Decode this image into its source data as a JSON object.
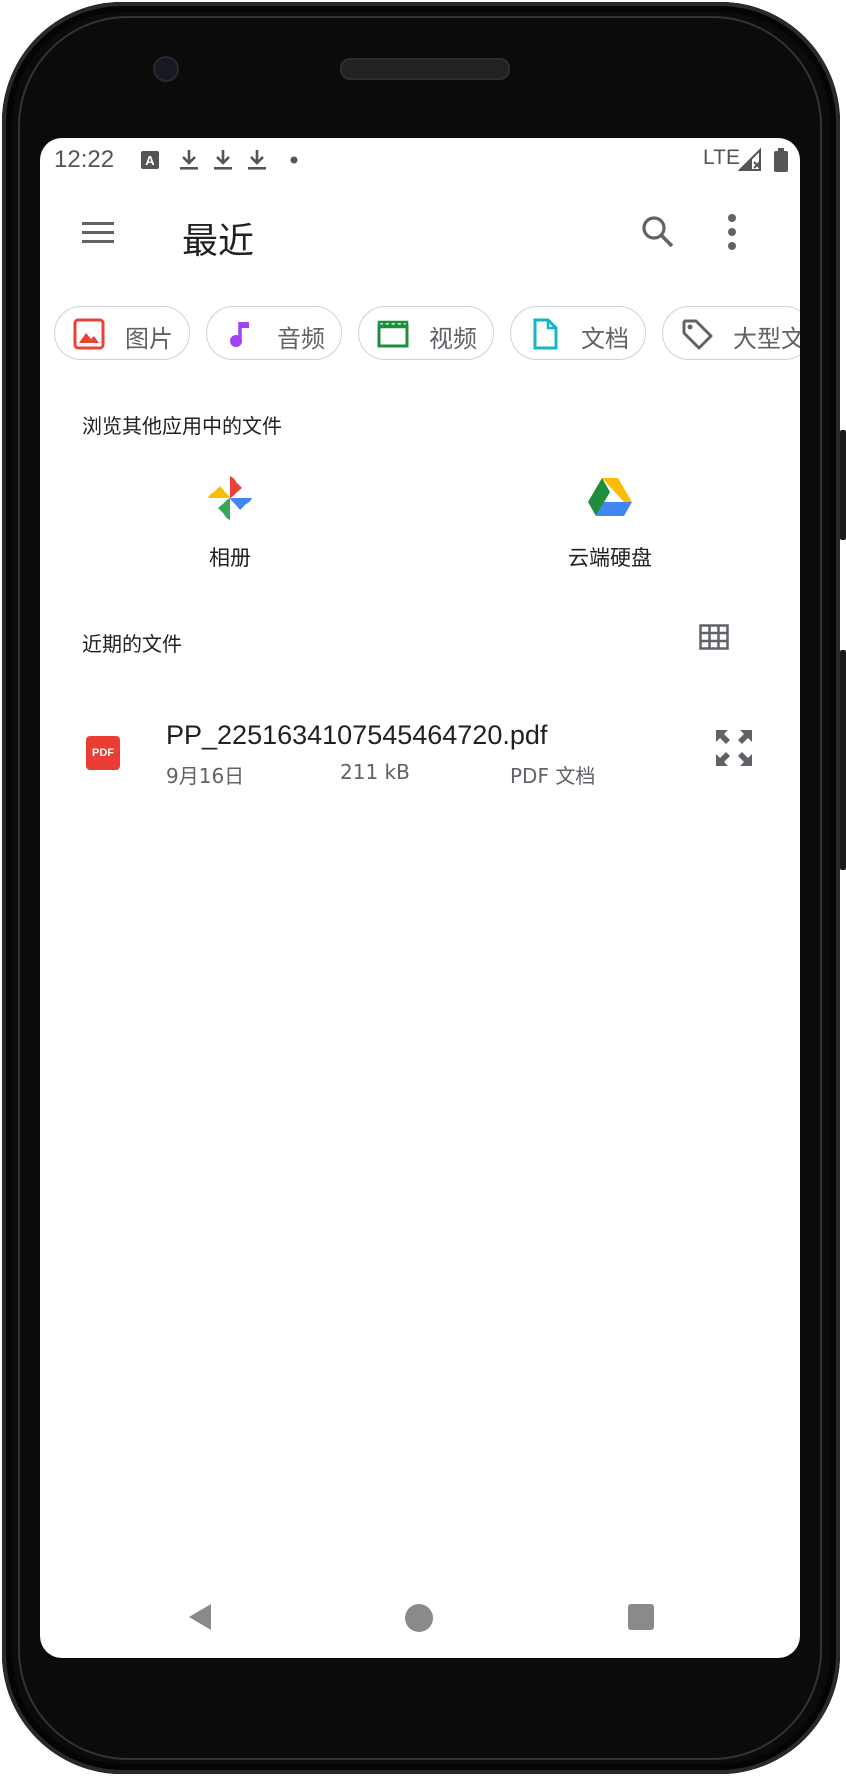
{
  "status_bar": {
    "time": "12:22",
    "network": "LTE",
    "icons": [
      "font-icon",
      "download-icon",
      "download-icon",
      "download-icon",
      "dot-icon",
      "signal-icon",
      "battery-icon"
    ]
  },
  "app_bar": {
    "title": "最近"
  },
  "chips": [
    {
      "label": "图片",
      "icon": "image-icon",
      "color": "#ea4335"
    },
    {
      "label": "音频",
      "icon": "music-note-icon",
      "color": "#a142f4"
    },
    {
      "label": "视频",
      "icon": "video-icon",
      "color": "#1e8e3e"
    },
    {
      "label": "文档",
      "icon": "document-icon",
      "color": "#12b5cb"
    },
    {
      "label": "大型文件",
      "icon": "tag-icon",
      "color": "#5f6368"
    }
  ],
  "browse_section": {
    "title": "浏览其他应用中的文件",
    "apps": [
      {
        "label": "相册",
        "icon": "google-photos-icon"
      },
      {
        "label": "云端硬盘",
        "icon": "google-drive-icon"
      }
    ]
  },
  "recent_section": {
    "title": "近期的文件"
  },
  "files": [
    {
      "badge": "PDF",
      "name": "PP_2251634107545464720.pdf",
      "date": "9月16日",
      "size": "211 kB",
      "type": "PDF 文档"
    }
  ]
}
